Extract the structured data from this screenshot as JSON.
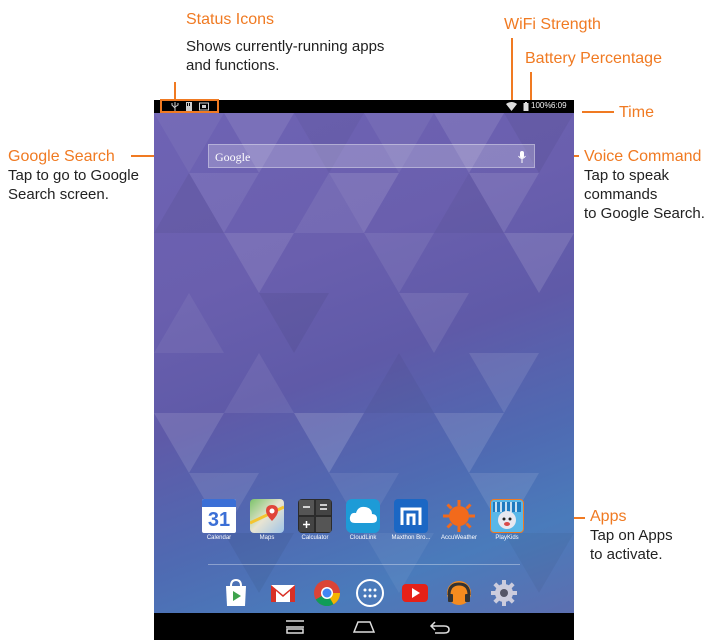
{
  "callouts": {
    "status_icons": {
      "title": "Status Icons",
      "desc1": "Shows currently-running apps",
      "desc2": "and functions."
    },
    "wifi": {
      "title": "WiFi Strength"
    },
    "battery": {
      "title": "Battery Percentage"
    },
    "time": {
      "title": "Time"
    },
    "google_search": {
      "title": "Google Search",
      "desc1": "Tap to go to Google",
      "desc2": "Search screen."
    },
    "voice": {
      "title": "Voice Command",
      "desc1": "Tap to speak",
      "desc2": "commands",
      "desc3": "to Google Search."
    },
    "apps": {
      "title": "Apps",
      "desc1": "Tap on Apps",
      "desc2": "to activate."
    }
  },
  "status_bar": {
    "battery_text": "100%",
    "time": "6:09",
    "icons": [
      "usb-icon",
      "sd-card-icon",
      "screenshot-icon"
    ]
  },
  "search": {
    "placeholder": "Google"
  },
  "apps": [
    {
      "label": "Calendar",
      "icon": "calendar-icon",
      "calendar_day": "31"
    },
    {
      "label": "Maps",
      "icon": "maps-icon"
    },
    {
      "label": "Calculator",
      "icon": "calculator-icon"
    },
    {
      "label": "CloudLink",
      "icon": "cloudlink-icon"
    },
    {
      "label": "Maxthon Bro...",
      "icon": "maxthon-icon"
    },
    {
      "label": "AccuWeather",
      "icon": "accuweather-icon"
    },
    {
      "label": "PlayKids",
      "icon": "playkids-icon"
    }
  ],
  "dock": [
    "play-store-icon",
    "gmail-icon",
    "chrome-icon",
    "app-drawer-icon",
    "youtube-icon",
    "play-music-icon",
    "settings-icon"
  ],
  "nav": [
    "recents-icon",
    "home-icon",
    "back-icon"
  ],
  "colors": {
    "accent": "#f07a22",
    "wallpaper_top": "#6e63b4",
    "wallpaper_bottom": "#4a7bbb"
  }
}
